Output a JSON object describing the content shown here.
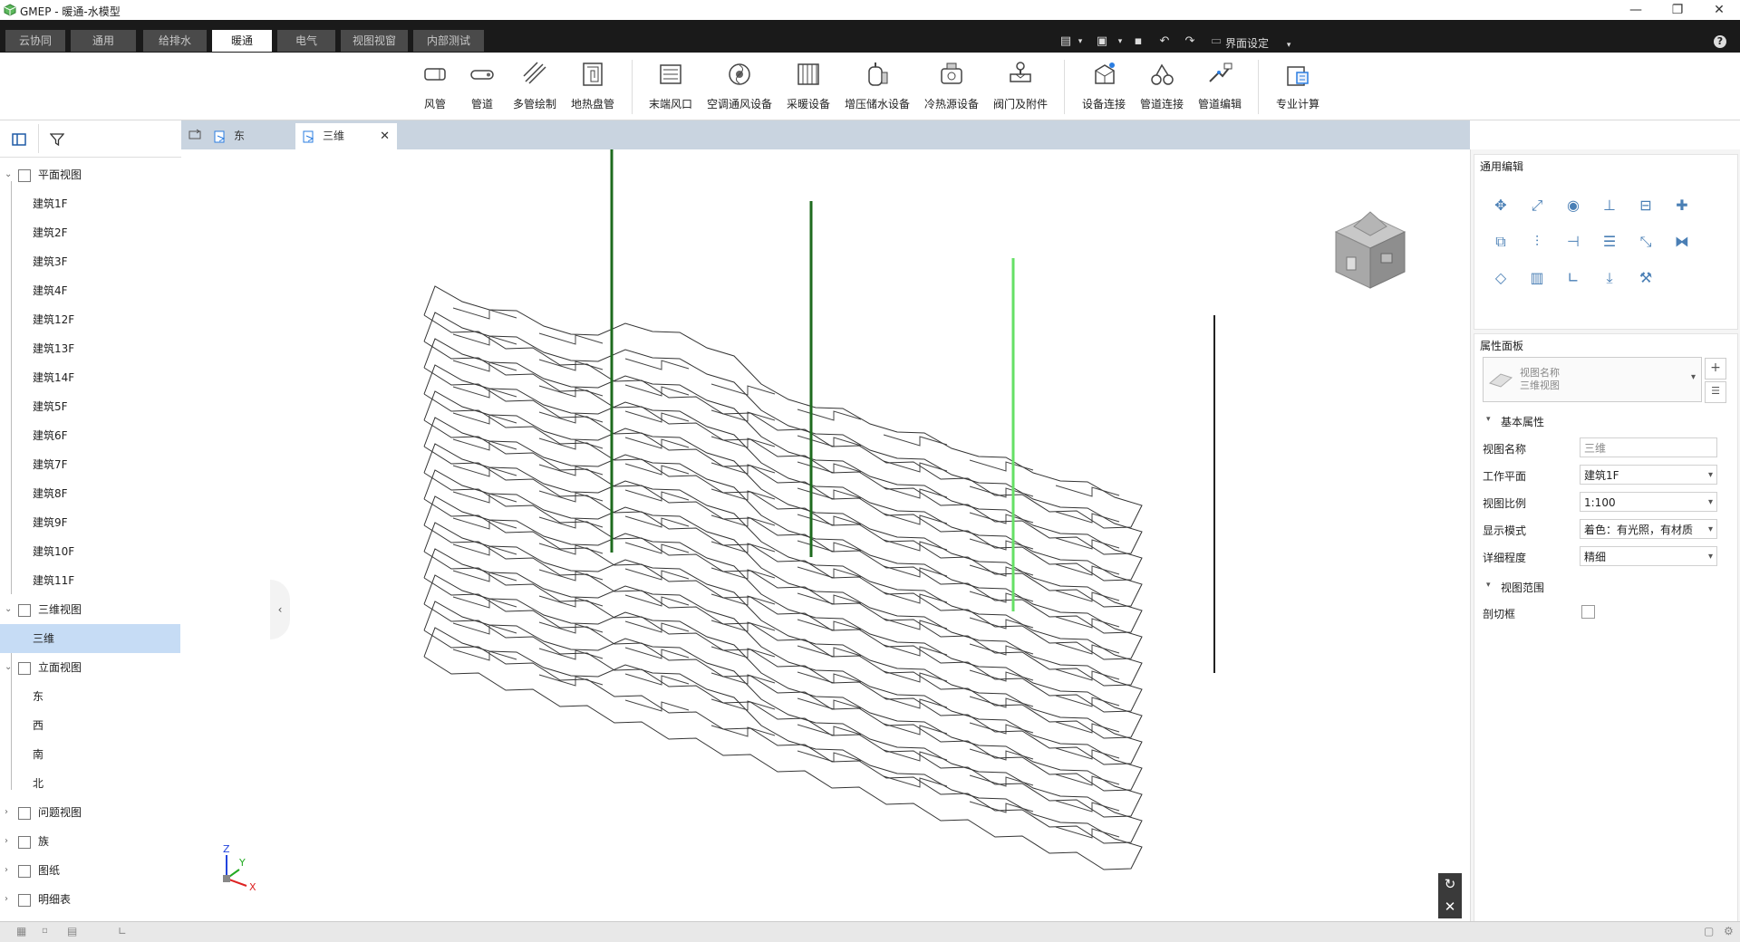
{
  "window": {
    "title": "GMEP - 暖通-水模型",
    "minimize_icon": "minimize-icon",
    "maximize_icon": "restore-icon",
    "close_icon": "close-icon"
  },
  "ribbon_tabs": [
    {
      "label": "云协同",
      "active": false
    },
    {
      "label": "通用",
      "active": false
    },
    {
      "label": "给排水",
      "active": false
    },
    {
      "label": "暖通",
      "active": true
    },
    {
      "label": "电气",
      "active": false
    },
    {
      "label": "视图视窗",
      "active": false
    },
    {
      "label": "内部测试",
      "active": false
    }
  ],
  "quick_access": {
    "ui_settings_label": "界面设定"
  },
  "ribbon_tools": [
    {
      "label": "风管",
      "icon": "duct-icon"
    },
    {
      "label": "管道",
      "icon": "pipe-icon"
    },
    {
      "label": "多管绘制",
      "icon": "multi-pipe-icon"
    },
    {
      "label": "地热盘管",
      "icon": "floor-heating-coil-icon"
    },
    {
      "label": "末端风口",
      "icon": "air-terminal-icon"
    },
    {
      "label": "空调通风设备",
      "icon": "hvac-fan-icon"
    },
    {
      "label": "采暖设备",
      "icon": "radiator-icon"
    },
    {
      "label": "增压储水设备",
      "icon": "water-tank-icon"
    },
    {
      "label": "冷热源设备",
      "icon": "heat-source-icon"
    },
    {
      "label": "阀门及附件",
      "icon": "valve-icon"
    },
    {
      "label": "设备连接",
      "icon": "equipment-connect-icon"
    },
    {
      "label": "管道连接",
      "icon": "pipe-connect-icon"
    },
    {
      "label": "管道编辑",
      "icon": "pipe-edit-icon"
    },
    {
      "label": "专业计算",
      "icon": "calculation-icon"
    }
  ],
  "project_tree": [
    {
      "label": "平面视图",
      "level": 0,
      "expanded": true
    },
    {
      "label": "建筑1F",
      "level": 1
    },
    {
      "label": "建筑2F",
      "level": 1
    },
    {
      "label": "建筑3F",
      "level": 1
    },
    {
      "label": "建筑4F",
      "level": 1
    },
    {
      "label": "建筑12F",
      "level": 1
    },
    {
      "label": "建筑13F",
      "level": 1
    },
    {
      "label": "建筑14F",
      "level": 1
    },
    {
      "label": "建筑5F",
      "level": 1
    },
    {
      "label": "建筑6F",
      "level": 1
    },
    {
      "label": "建筑7F",
      "level": 1
    },
    {
      "label": "建筑8F",
      "level": 1
    },
    {
      "label": "建筑9F",
      "level": 1
    },
    {
      "label": "建筑10F",
      "level": 1
    },
    {
      "label": "建筑11F",
      "level": 1
    },
    {
      "label": "三维视图",
      "level": 0,
      "expanded": true
    },
    {
      "label": "三维",
      "level": 1,
      "selected": true
    },
    {
      "label": "立面视图",
      "level": 0,
      "expanded": true
    },
    {
      "label": "东",
      "level": 1
    },
    {
      "label": "西",
      "level": 1
    },
    {
      "label": "南",
      "level": 1
    },
    {
      "label": "北",
      "level": 1
    },
    {
      "label": "问题视图",
      "level": 0,
      "expanded": false
    },
    {
      "label": "族",
      "level": 0,
      "expanded": false
    },
    {
      "label": "图纸",
      "level": 0,
      "expanded": false
    },
    {
      "label": "明细表",
      "level": 0,
      "expanded": false
    }
  ],
  "view_tabs": [
    {
      "label": "东",
      "active": false
    },
    {
      "label": "三维",
      "active": true
    }
  ],
  "right_panel": {
    "edit_title": "通用编辑",
    "edit_icons": [
      "move-icon",
      "scale-icon",
      "rotate-icon",
      "align-icon",
      "split-icon",
      "join-icon",
      "copy-icon",
      "offset-icon",
      "trim-icon",
      "distribute-icon",
      "array-icon",
      "mirror-icon",
      "erase-icon",
      "measure-icon",
      "angle-icon",
      "elevation-icon",
      "pipe-tool-icon"
    ],
    "props_title": "属性面板",
    "type_selector": {
      "line1": "视图名称",
      "line2": "三维视图"
    },
    "basic_group": "基本属性",
    "properties": [
      {
        "label": "视图名称",
        "value": "三维",
        "dropdown": false
      },
      {
        "label": "工作平面",
        "value": "建筑1F",
        "dropdown": true
      },
      {
        "label": "视图比例",
        "value": "1:100",
        "dropdown": true
      },
      {
        "label": "显示模式",
        "value": "着色：有光照，有材质",
        "dropdown": true
      },
      {
        "label": "详细程度",
        "value": "精细",
        "dropdown": true
      }
    ],
    "range_group": "视图范围",
    "section_box_label": "剖切框",
    "section_box_checked": false
  },
  "axes": {
    "x": "X",
    "y": "Y",
    "z": "Z"
  },
  "colors": {
    "riser_dark": "#1e6b1e",
    "riser_bright": "#66e066",
    "riser_black": "#222222",
    "tab_active_bg": "#ffffff",
    "tree_selected": "#c6dcf5"
  }
}
